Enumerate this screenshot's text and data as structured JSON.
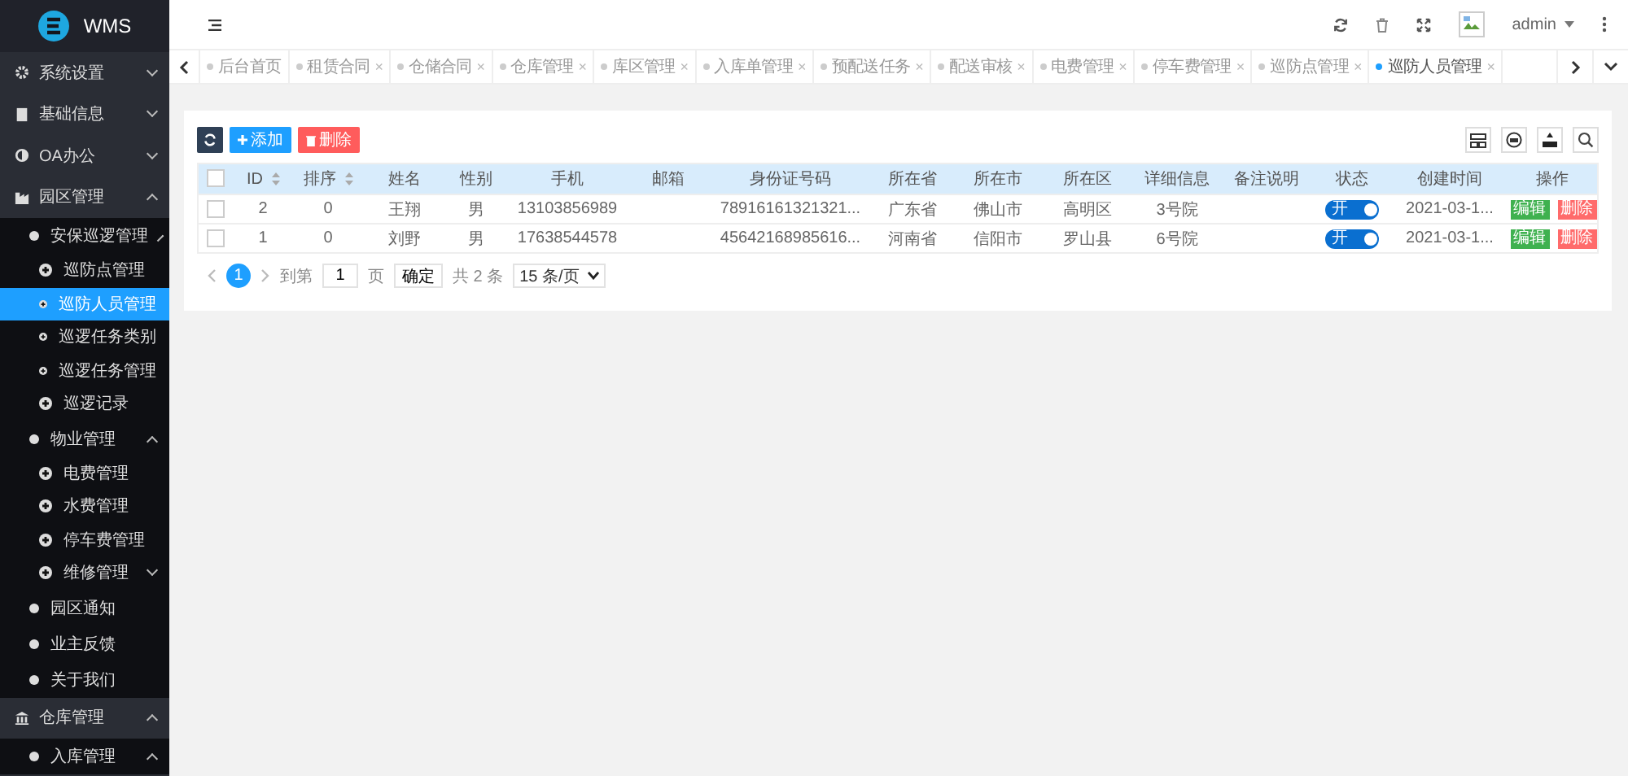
{
  "sidebar": {
    "logo": "WMS",
    "items": [
      {
        "label": "系统设置",
        "expanded": false
      },
      {
        "label": "基础信息",
        "expanded": false
      },
      {
        "label": "OA办公",
        "expanded": false
      },
      {
        "label": "园区管理",
        "expanded": true,
        "children": [
          {
            "label": "安保巡逻管理",
            "expanded": true,
            "children": [
              {
                "label": "巡防点管理",
                "selected": false
              },
              {
                "label": "巡防人员管理",
                "selected": true
              },
              {
                "label": "巡逻任务类别",
                "selected": false
              },
              {
                "label": "巡逻任务管理",
                "selected": false
              },
              {
                "label": "巡逻记录",
                "selected": false
              }
            ]
          },
          {
            "label": "物业管理",
            "expanded": true,
            "children": [
              {
                "label": "电费管理",
                "selected": false
              },
              {
                "label": "水费管理",
                "selected": false
              },
              {
                "label": "停车费管理",
                "selected": false
              },
              {
                "label": "维修管理",
                "expanded": false
              }
            ]
          },
          {
            "label": "园区通知",
            "selected": false
          },
          {
            "label": "业主反馈",
            "selected": false
          },
          {
            "label": "关于我们",
            "selected": false
          }
        ]
      },
      {
        "label": "仓库管理",
        "expanded": true,
        "children": [
          {
            "label": "入库管理",
            "expanded": true
          }
        ]
      }
    ]
  },
  "header": {
    "user": "admin"
  },
  "tabs": [
    {
      "label": "后台首页",
      "selected": false
    },
    {
      "label": "租赁合同",
      "selected": false,
      "close": "×"
    },
    {
      "label": "仓储合同",
      "selected": false,
      "close": "×"
    },
    {
      "label": "仓库管理",
      "selected": false,
      "close": "×"
    },
    {
      "label": "库区管理",
      "selected": false,
      "close": "×"
    },
    {
      "label": "入库单管理",
      "selected": false,
      "close": "×"
    },
    {
      "label": "预配送任务",
      "selected": false,
      "close": "×"
    },
    {
      "label": "配送审核",
      "selected": false,
      "close": "×"
    },
    {
      "label": "电费管理",
      "selected": false,
      "close": "×"
    },
    {
      "label": "停车费管理",
      "selected": false,
      "close": "×"
    },
    {
      "label": "巡防点管理",
      "selected": false,
      "close": "×"
    },
    {
      "label": "巡防人员管理",
      "selected": true,
      "close": "×"
    }
  ],
  "toolbar": {
    "add": "添加",
    "delete": "删除"
  },
  "table": {
    "columns": [
      {
        "label": "ID",
        "sortable": true
      },
      {
        "label": "排序",
        "sortable": true
      },
      {
        "label": "姓名",
        "sortable": false
      },
      {
        "label": "性别",
        "sortable": false
      },
      {
        "label": "手机",
        "sortable": false
      },
      {
        "label": "邮箱",
        "sortable": false
      },
      {
        "label": "身份证号码",
        "sortable": false
      },
      {
        "label": "所在省",
        "sortable": false
      },
      {
        "label": "所在市",
        "sortable": false
      },
      {
        "label": "所在区",
        "sortable": false
      },
      {
        "label": "详细信息",
        "sortable": false
      },
      {
        "label": "备注说明",
        "sortable": false
      },
      {
        "label": "状态",
        "sortable": false
      },
      {
        "label": "创建时间",
        "sortable": false
      },
      {
        "label": "操作",
        "sortable": false
      }
    ],
    "header_checked": false,
    "rows": [
      {
        "checked": false,
        "id": "2",
        "order": "0",
        "name": "王翔",
        "gender": "男",
        "phone": "13103856989",
        "id_card": "78916161321321...",
        "province": "广东省",
        "city": "佛山市",
        "district": "高明区",
        "detail": "3号院",
        "on": true,
        "switch_label": "开",
        "created": "2021-03-1...",
        "edit": "编辑",
        "delete": "删除"
      },
      {
        "checked": false,
        "id": "1",
        "order": "0",
        "name": "刘野",
        "gender": "男",
        "phone": "17638544578",
        "id_card": "45642168985616...",
        "province": "河南省",
        "city": "信阳市",
        "district": "罗山县",
        "detail": "6号院",
        "on": true,
        "switch_label": "开",
        "created": "2021-03-1...",
        "edit": "编辑",
        "delete": "删除"
      }
    ]
  },
  "pagination": {
    "current": "1",
    "goto_label": "到第",
    "page_input": "1",
    "page_label": "页",
    "confirm": "确定",
    "total": "共 2 条",
    "page_size": "15 条/页"
  }
}
